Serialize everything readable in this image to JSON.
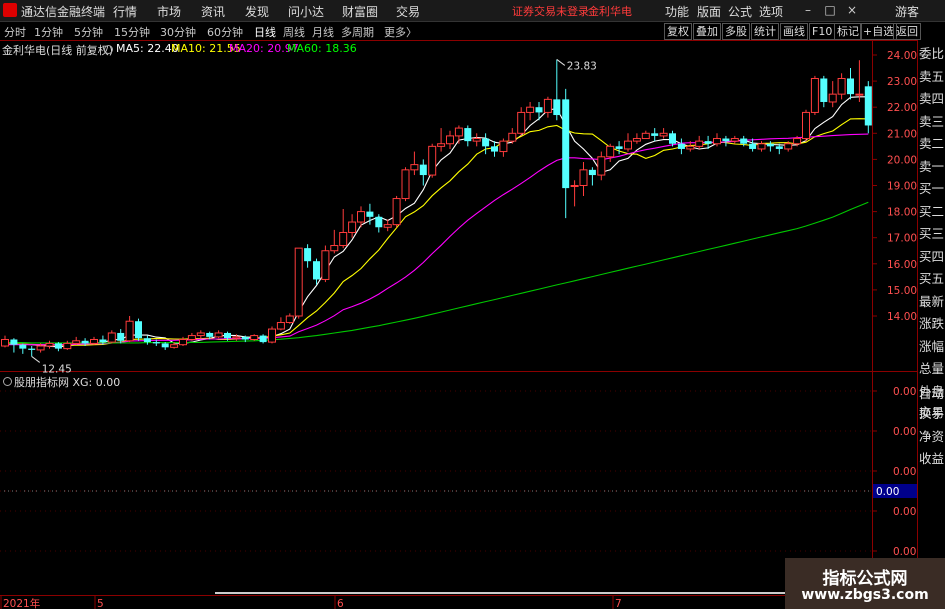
{
  "app": {
    "title": "通达信金融终端"
  },
  "menu": [
    "行情",
    "市场",
    "资讯",
    "发现",
    "问小达",
    "财富圈",
    "交易"
  ],
  "notice": {
    "trade_status": "证券交易未登录",
    "stock_name": "金利华电"
  },
  "right_menu": [
    "功能",
    "版面",
    "公式",
    "选项"
  ],
  "guest_label": "游客",
  "window_buttons": {
    "min": "–",
    "restore": "□",
    "close": "×"
  },
  "periods": [
    "分时",
    "1分钟",
    "5分钟",
    "15分钟",
    "30分钟",
    "60分钟",
    "日线",
    "周线",
    "月线",
    "多周期",
    "更多〉"
  ],
  "active_period": "日线",
  "tools": [
    "复权",
    "叠加",
    "多股",
    "统计",
    "画线",
    "F10",
    "标记",
    "+自选",
    "返回"
  ],
  "main_legend": {
    "stock_label": "金利华电(日线 前复权)",
    "ma": [
      {
        "label": "MA5: 22.40",
        "color": "#ffffff"
      },
      {
        "label": "MA10: 21.55",
        "color": "#ffff00"
      },
      {
        "label": "MA20: 20.97",
        "color": "#ff00ff"
      },
      {
        "label": "MA60: 18.36",
        "color": "#00ff00"
      }
    ]
  },
  "sub_legend": {
    "indicator_label": "股朋指标网 XG: 0.00"
  },
  "side_panel": [
    "委比",
    "卖五",
    "卖四",
    "卖三",
    "卖二",
    "卖一",
    "买一",
    "买二",
    "买三",
    "买四",
    "买五",
    "最新",
    "涨跌",
    "涨幅",
    "总量",
    "外盘",
    "换手",
    "净资",
    "收益",
    "自动",
    "交易"
  ],
  "watermark": {
    "line1": "指标公式网",
    "line2": "www.zbgs3.com"
  },
  "colors": {
    "up": "#ff3c3c",
    "down": "#54ffff",
    "grid": "#8b0000",
    "axis_text": "#ff5050",
    "ma5": "#ffffff",
    "ma10": "#ffff00",
    "ma20": "#ff00ff",
    "ma60": "#00c800"
  },
  "chart_data": [
    {
      "type": "candlestick",
      "title": "金利华电(日线 前复权)",
      "y_ticks": [
        "24.00",
        "23.00",
        "22.00",
        "21.00",
        "20.00",
        "19.00",
        "18.00",
        "17.00",
        "16.00",
        "15.00",
        "14.00"
      ],
      "ylim": [
        12.0,
        24.5
      ],
      "x_tick_labels": [
        "2021年",
        "5",
        "6",
        "7"
      ],
      "annotations": [
        {
          "text": "23.83",
          "type": "high"
        },
        {
          "text": "12.45",
          "type": "low"
        }
      ],
      "candles": [
        [
          12.85,
          13.1,
          13.25,
          12.8
        ],
        [
          13.1,
          12.9,
          13.15,
          12.6
        ],
        [
          12.9,
          12.75,
          12.95,
          12.55
        ],
        [
          12.75,
          12.7,
          12.85,
          12.45
        ],
        [
          12.7,
          12.85,
          12.95,
          12.6
        ],
        [
          12.85,
          12.95,
          13.05,
          12.75
        ],
        [
          12.95,
          12.75,
          13.0,
          12.65
        ],
        [
          12.75,
          12.95,
          13.05,
          12.7
        ],
        [
          12.95,
          13.05,
          13.2,
          12.9
        ],
        [
          13.05,
          12.95,
          13.15,
          12.85
        ],
        [
          12.95,
          13.1,
          13.2,
          12.9
        ],
        [
          13.1,
          13.0,
          13.25,
          12.9
        ],
        [
          13.0,
          13.35,
          13.45,
          12.95
        ],
        [
          13.35,
          13.05,
          13.5,
          12.95
        ],
        [
          13.05,
          13.8,
          14.0,
          13.0
        ],
        [
          13.8,
          13.15,
          13.9,
          13.05
        ],
        [
          13.15,
          13.0,
          13.25,
          12.9
        ],
        [
          13.0,
          12.95,
          13.1,
          12.85
        ],
        [
          12.95,
          12.8,
          13.0,
          12.7
        ],
        [
          12.8,
          12.9,
          13.0,
          12.75
        ],
        [
          12.9,
          13.1,
          13.2,
          12.85
        ],
        [
          13.1,
          13.25,
          13.35,
          13.05
        ],
        [
          13.25,
          13.35,
          13.45,
          13.15
        ],
        [
          13.35,
          13.2,
          13.4,
          13.1
        ],
        [
          13.2,
          13.35,
          13.45,
          13.15
        ],
        [
          13.35,
          13.15,
          13.4,
          13.05
        ],
        [
          13.15,
          13.2,
          13.3,
          13.05
        ],
        [
          13.2,
          13.1,
          13.25,
          13.0
        ],
        [
          13.1,
          13.25,
          13.3,
          13.05
        ],
        [
          13.25,
          13.0,
          13.3,
          12.95
        ],
        [
          13.0,
          13.5,
          13.6,
          12.95
        ],
        [
          13.5,
          13.75,
          13.95,
          13.45
        ],
        [
          13.75,
          14.0,
          14.1,
          13.7
        ],
        [
          14.0,
          16.6,
          16.6,
          13.9
        ],
        [
          16.6,
          16.1,
          16.75,
          15.85
        ],
        [
          16.1,
          15.4,
          16.2,
          15.2
        ],
        [
          15.4,
          16.5,
          16.7,
          15.3
        ],
        [
          16.5,
          16.7,
          17.3,
          16.4
        ],
        [
          16.7,
          17.2,
          18.1,
          16.6
        ],
        [
          17.2,
          17.6,
          17.9,
          17.0
        ],
        [
          17.6,
          18.0,
          18.2,
          17.4
        ],
        [
          18.0,
          17.8,
          18.3,
          17.5
        ],
        [
          17.8,
          17.4,
          17.9,
          17.2
        ],
        [
          17.4,
          17.5,
          17.7,
          17.25
        ],
        [
          17.5,
          18.5,
          18.6,
          17.4
        ],
        [
          18.5,
          19.6,
          19.7,
          18.4
        ],
        [
          19.6,
          19.8,
          20.3,
          19.4
        ],
        [
          19.8,
          19.4,
          20.0,
          19.0
        ],
        [
          19.4,
          20.5,
          20.6,
          19.3
        ],
        [
          20.5,
          20.6,
          21.2,
          20.3
        ],
        [
          20.6,
          20.9,
          21.1,
          20.4
        ],
        [
          20.9,
          21.2,
          21.3,
          20.6
        ],
        [
          21.2,
          20.7,
          21.3,
          20.5
        ],
        [
          20.7,
          20.8,
          21.0,
          20.5
        ],
        [
          20.8,
          20.5,
          21.0,
          20.2
        ],
        [
          20.5,
          20.3,
          20.7,
          20.1
        ],
        [
          20.3,
          20.7,
          20.8,
          20.1
        ],
        [
          20.7,
          21.0,
          21.2,
          20.6
        ],
        [
          21.0,
          21.8,
          22.0,
          20.9
        ],
        [
          21.8,
          22.0,
          22.2,
          21.5
        ],
        [
          22.0,
          21.8,
          22.2,
          21.5
        ],
        [
          21.8,
          22.3,
          22.4,
          21.6
        ],
        [
          22.3,
          21.7,
          23.83,
          21.5
        ],
        [
          22.3,
          18.9,
          22.7,
          17.75
        ],
        [
          19.0,
          19.0,
          19.2,
          18.2
        ],
        [
          19.0,
          19.6,
          19.9,
          18.6
        ],
        [
          19.6,
          19.4,
          19.7,
          19.0
        ],
        [
          19.4,
          20.1,
          20.3,
          19.2
        ],
        [
          20.1,
          20.5,
          20.6,
          19.9
        ],
        [
          20.5,
          20.4,
          20.7,
          20.2
        ],
        [
          20.4,
          20.7,
          21.0,
          20.3
        ],
        [
          20.7,
          20.8,
          21.0,
          20.6
        ],
        [
          20.8,
          21.0,
          21.1,
          20.8
        ],
        [
          21.0,
          20.9,
          21.2,
          20.7
        ],
        [
          20.9,
          21.0,
          21.2,
          20.8
        ],
        [
          21.0,
          20.6,
          21.1,
          20.5
        ],
        [
          20.6,
          20.4,
          20.8,
          20.2
        ],
        [
          20.4,
          20.5,
          20.7,
          20.3
        ],
        [
          20.5,
          20.7,
          20.9,
          20.4
        ],
        [
          20.7,
          20.6,
          20.9,
          20.4
        ],
        [
          20.6,
          20.8,
          21.0,
          20.5
        ],
        [
          20.8,
          20.7,
          20.9,
          20.5
        ],
        [
          20.7,
          20.8,
          20.9,
          20.6
        ],
        [
          20.8,
          20.6,
          20.9,
          20.5
        ],
        [
          20.6,
          20.4,
          20.8,
          20.3
        ],
        [
          20.4,
          20.6,
          20.7,
          20.3
        ],
        [
          20.6,
          20.5,
          20.7,
          20.3
        ],
        [
          20.5,
          20.4,
          20.6,
          20.2
        ],
        [
          20.4,
          20.6,
          20.7,
          20.3
        ],
        [
          20.6,
          20.8,
          20.9,
          20.5
        ],
        [
          20.8,
          21.8,
          21.9,
          20.7
        ],
        [
          21.8,
          23.1,
          23.2,
          21.7
        ],
        [
          23.1,
          22.2,
          23.2,
          22.0
        ],
        [
          22.2,
          22.5,
          23.0,
          22.0
        ],
        [
          22.5,
          23.1,
          23.3,
          22.3
        ],
        [
          23.1,
          22.5,
          23.5,
          22.3
        ],
        [
          22.5,
          22.5,
          23.8,
          22.2
        ],
        [
          22.8,
          21.3,
          23.0,
          21.0
        ]
      ],
      "series": [
        {
          "name": "MA5",
          "values": [
            12.92,
            12.93,
            12.92,
            12.9,
            12.87,
            12.84,
            12.82,
            12.85,
            12.9,
            12.93,
            12.96,
            12.98,
            13.09,
            13.1,
            13.27,
            13.27,
            13.27,
            13.19,
            13.16,
            12.96,
            12.95,
            13.0,
            13.08,
            13.14,
            13.23,
            13.26,
            13.25,
            13.2,
            13.18,
            13.14,
            13.21,
            13.32,
            13.5,
            14.17,
            14.74,
            15.17,
            15.72,
            16.26,
            16.48,
            16.92,
            17.48,
            17.66,
            17.8,
            17.66,
            17.84,
            18.12,
            18.32,
            18.84,
            19.56,
            19.98,
            20.24,
            20.74,
            20.8,
            20.84,
            20.82,
            20.66,
            20.6,
            20.66,
            20.92,
            21.3,
            21.56,
            21.9,
            21.94,
            21.32,
            20.7,
            20.4,
            20.04,
            19.5,
            19.6,
            19.94,
            20.04,
            20.36,
            20.58,
            20.7,
            20.76,
            20.76,
            20.6,
            20.48,
            20.4,
            20.44,
            20.62,
            20.68,
            20.71,
            20.74,
            20.63,
            20.6,
            20.57,
            20.56,
            20.54,
            20.56,
            20.72,
            21.18,
            21.42,
            21.64,
            22.1,
            22.38,
            22.4,
            22.4
          ]
        },
        {
          "name": "MA10",
          "values": [
            12.92,
            12.93,
            12.92,
            12.91,
            12.9,
            12.89,
            12.88,
            12.88,
            12.88,
            12.88,
            12.9,
            12.91,
            12.97,
            13.0,
            13.1,
            13.11,
            13.12,
            13.14,
            13.13,
            13.12,
            13.11,
            13.13,
            13.13,
            13.15,
            13.1,
            13.1,
            13.12,
            13.14,
            13.16,
            13.17,
            13.23,
            13.28,
            13.35,
            13.64,
            13.94,
            14.19,
            14.52,
            14.88,
            15.32,
            15.55,
            15.82,
            16.19,
            16.53,
            16.97,
            17.38,
            17.8,
            17.99,
            18.23,
            18.61,
            18.91,
            19.18,
            19.53,
            19.82,
            20.2,
            20.4,
            20.45,
            20.67,
            20.73,
            20.88,
            21.06,
            21.11,
            21.25,
            21.3,
            21.12,
            21.01,
            20.98,
            20.97,
            20.72,
            20.46,
            20.32,
            20.22,
            20.2,
            20.04,
            20.15,
            20.35,
            20.4,
            20.48,
            20.53,
            20.55,
            20.6,
            20.69,
            20.64,
            20.59,
            20.57,
            20.53,
            20.61,
            20.62,
            20.64,
            20.64,
            20.59,
            20.66,
            20.87,
            20.99,
            21.09,
            21.33,
            21.55,
            21.56,
            21.55
          ]
        },
        {
          "name": "MA20",
          "values": [
            12.9,
            12.9,
            12.9,
            12.9,
            12.9,
            12.9,
            12.9,
            12.91,
            12.92,
            12.93,
            12.94,
            12.94,
            12.97,
            12.99,
            13.04,
            13.05,
            13.06,
            13.07,
            13.07,
            13.07,
            13.08,
            13.09,
            13.11,
            13.12,
            13.12,
            13.13,
            13.13,
            13.13,
            13.14,
            13.14,
            13.17,
            13.2,
            13.23,
            13.4,
            13.52,
            13.65,
            13.82,
            14.01,
            14.24,
            14.36,
            14.49,
            14.65,
            14.84,
            15.06,
            15.27,
            15.49,
            15.75,
            16.05,
            16.39,
            16.71,
            17.05,
            17.37,
            17.67,
            17.93,
            18.18,
            18.43,
            18.65,
            18.86,
            19.08,
            19.31,
            19.55,
            19.77,
            19.96,
            20.06,
            20.06,
            20.03,
            20.02,
            19.99,
            20.05,
            20.12,
            20.21,
            20.3,
            20.37,
            20.43,
            20.5,
            20.56,
            20.62,
            20.64,
            20.64,
            20.65,
            20.66,
            20.67,
            20.69,
            20.73,
            20.75,
            20.77,
            20.79,
            20.8,
            20.81,
            20.83,
            20.85,
            20.87,
            20.89,
            20.91,
            20.93,
            20.95,
            20.96,
            20.97
          ]
        },
        {
          "name": "MA60",
          "values": [
            12.98,
            12.98,
            12.98,
            12.97,
            12.97,
            12.97,
            12.97,
            12.97,
            12.97,
            12.97,
            12.97,
            12.97,
            12.97,
            12.97,
            12.97,
            12.97,
            12.98,
            12.98,
            12.98,
            12.98,
            12.98,
            12.99,
            12.99,
            13.0,
            13.01,
            13.02,
            13.03,
            13.04,
            13.05,
            13.07,
            13.09,
            13.11,
            13.14,
            13.17,
            13.21,
            13.25,
            13.3,
            13.35,
            13.4,
            13.45,
            13.51,
            13.57,
            13.63,
            13.7,
            13.77,
            13.84,
            13.91,
            13.99,
            14.07,
            14.15,
            14.23,
            14.31,
            14.39,
            14.47,
            14.55,
            14.63,
            14.71,
            14.79,
            14.87,
            14.95,
            15.03,
            15.11,
            15.19,
            15.27,
            15.35,
            15.43,
            15.51,
            15.59,
            15.67,
            15.75,
            15.83,
            15.91,
            15.99,
            16.07,
            16.15,
            16.23,
            16.31,
            16.39,
            16.47,
            16.55,
            16.63,
            16.71,
            16.79,
            16.87,
            16.95,
            17.03,
            17.11,
            17.19,
            17.27,
            17.35,
            17.45,
            17.56,
            17.67,
            17.79,
            17.93,
            18.08,
            18.22,
            18.36
          ]
        }
      ]
    },
    {
      "type": "line",
      "title": "股朋指标网",
      "series": [
        {
          "name": "XG",
          "values": [
            0
          ]
        }
      ],
      "y_ticks": [
        "0.00",
        "0.00",
        "0.00",
        "0.00",
        "0.00",
        "0.00"
      ],
      "current_value": "0.00"
    }
  ]
}
